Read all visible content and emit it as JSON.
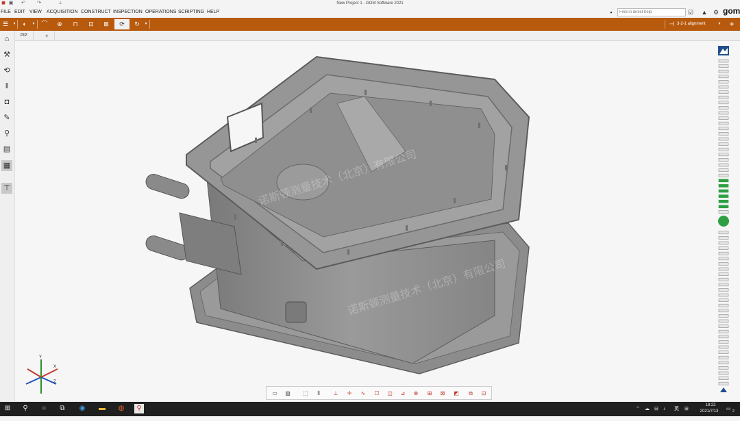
{
  "window": {
    "title": "New Project 1 - GOM Software 2021"
  },
  "menu": {
    "items": [
      "FILE",
      "EDIT",
      "VIEW",
      "ACQUISITION",
      "CONSTRUCT",
      "INSPECTION",
      "OPERATIONS",
      "SCRIPTING",
      "HELP"
    ],
    "help_search_placeholder": "Find in direct help",
    "logo": "gom"
  },
  "toolbar": {
    "alignment_label": "3-2-1 alignment",
    "accent_color": "#b75a0e"
  },
  "tabs": {
    "items": [
      "PIP",
      "+"
    ]
  },
  "viewport": {
    "watermark": "诺斯顿测量技术（北京）有限公司",
    "axis_labels": {
      "x": "X",
      "y": "Y",
      "z": "Z"
    }
  },
  "taskbar": {
    "tray_lang": "英",
    "time": "18:22",
    "date": "2021/7/13",
    "notification_count": "2"
  }
}
